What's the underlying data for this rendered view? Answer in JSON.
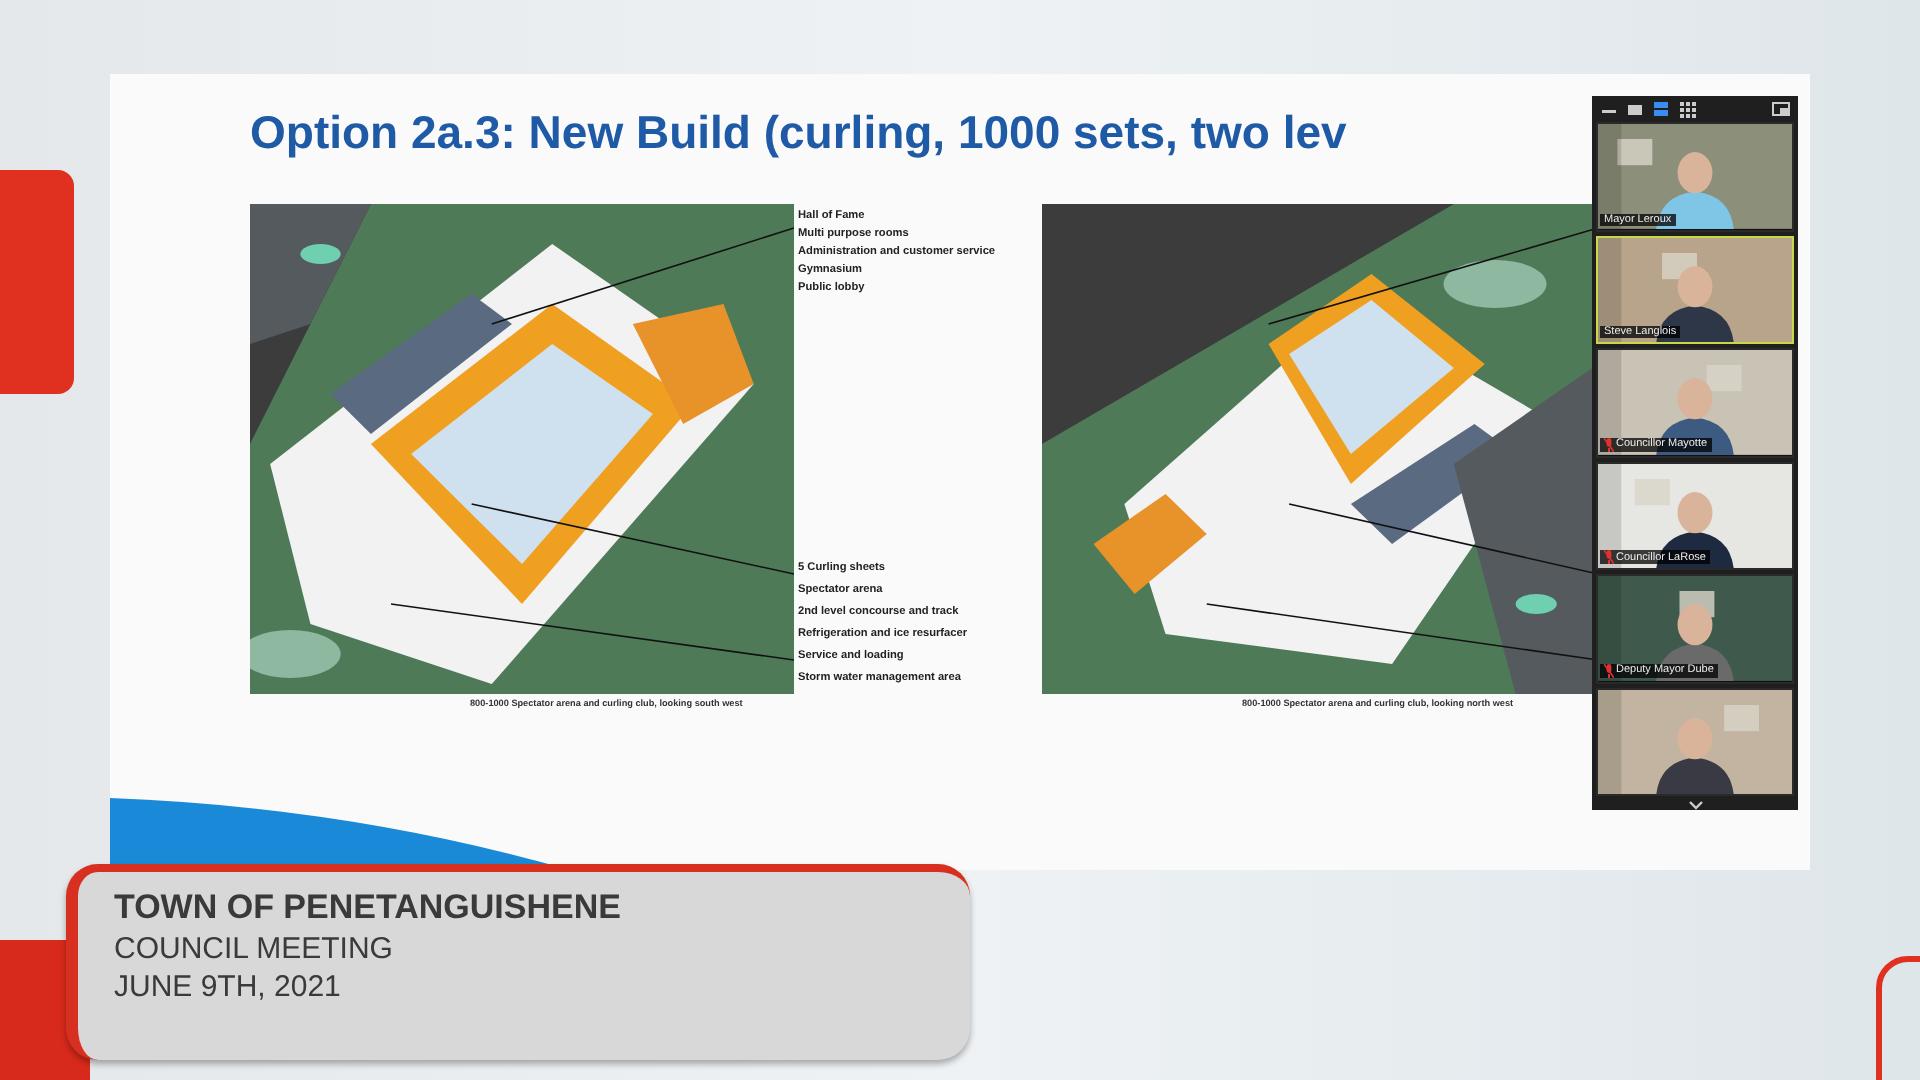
{
  "slide": {
    "title": "Option 2a.3: New Build (curling, 1000 sets, two lev",
    "figures": [
      {
        "kind": "picture",
        "top_labels": [
          "Hall of Fame",
          "Multi purpose rooms",
          "Administration and customer service",
          "Gymnasium",
          "Public lobby"
        ],
        "bottom_labels": [
          "5 Curling sheets",
          "Spectator arena",
          "2nd level concourse and track",
          "Refrigeration and ice resurfacer",
          "Service and loading",
          "Storm water management area"
        ],
        "caption": "800-1000 Spectator arena and curling club, looking south west"
      },
      {
        "kind": "picture",
        "caption": "800-1000 Spectator arena and curling club, looking north west"
      }
    ]
  },
  "video_panel": {
    "participants": [
      {
        "name": "Mayor Leroux",
        "muted": false,
        "speaking": false
      },
      {
        "name": "Steve Langlois",
        "muted": false,
        "speaking": true
      },
      {
        "name": "Councillor Mayotte",
        "muted": true,
        "speaking": false
      },
      {
        "name": "Councillor LaRose",
        "muted": true,
        "speaking": false
      },
      {
        "name": "Deputy Mayor Dube",
        "muted": true,
        "speaking": false
      },
      {
        "speaking": false
      }
    ]
  },
  "lower_third": {
    "title": "TOWN OF PENETANGUISHENE",
    "subtitle": "COUNCIL MEETING",
    "date": "JUNE 9TH, 2021"
  }
}
